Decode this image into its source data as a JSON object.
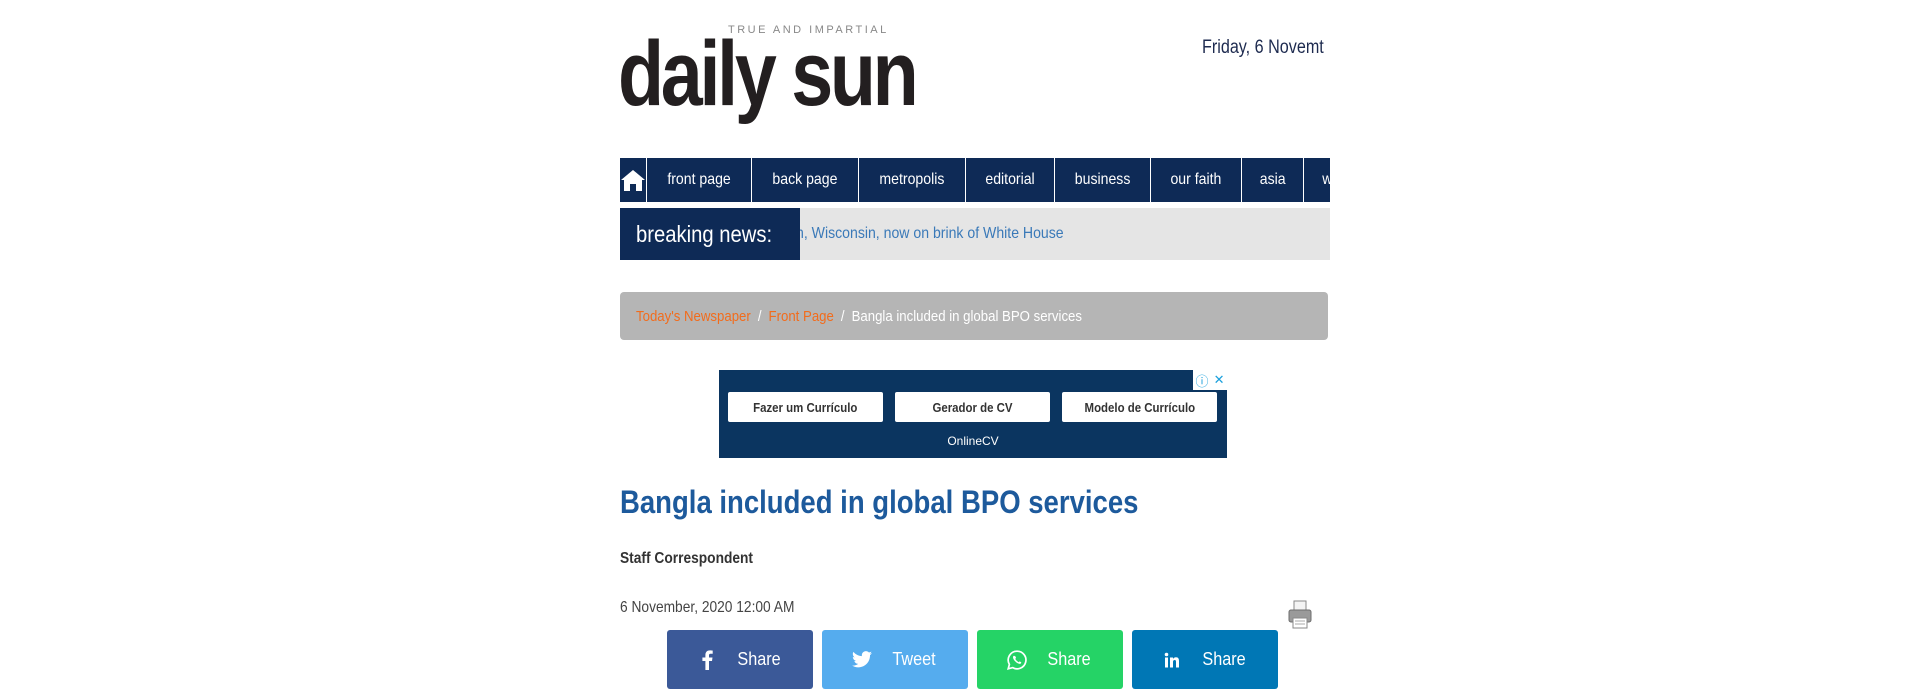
{
  "header": {
    "logo_text": "daily sun",
    "logo_tagline": "TRUE AND IMPARTIAL",
    "date": "Friday, 6 Novemt"
  },
  "nav": {
    "items": [
      {
        "label": "front page"
      },
      {
        "label": "back page"
      },
      {
        "label": "metropolis"
      },
      {
        "label": "editorial"
      },
      {
        "label": "business"
      },
      {
        "label": "our faith"
      },
      {
        "label": "asia"
      },
      {
        "label": "world"
      }
    ]
  },
  "breaking": {
    "label": "breaking news:",
    "text": "n, Wisconsin, now on brink of White House"
  },
  "breadcrumb": {
    "items": [
      "Today's Newspaper",
      "Front Page"
    ],
    "current": "Bangla included in global BPO services",
    "separator": "/"
  },
  "ad": {
    "buttons": [
      "Fazer um Currículo",
      "Gerador de CV",
      "Modelo de Currículo"
    ],
    "footer": "OnlineCV"
  },
  "article": {
    "title": "Bangla included in global BPO services",
    "author": "Staff Correspondent",
    "date": "6 November, 2020 12:00 AM"
  },
  "share": [
    {
      "label": "Share",
      "icon": "facebook-icon",
      "color": "#3b5998"
    },
    {
      "label": "Tweet",
      "icon": "twitter-icon",
      "color": "#55acee"
    },
    {
      "label": "Share",
      "icon": "whatsapp-icon",
      "color": "#25d366"
    },
    {
      "label": "Share",
      "icon": "linkedin-icon",
      "color": "#0077b5"
    }
  ],
  "colors": {
    "nav_bg": "#0e2a56",
    "link_orange": "#f26c1c",
    "title_blue": "#1d5a9c",
    "breaking_text": "#3a79b8"
  }
}
